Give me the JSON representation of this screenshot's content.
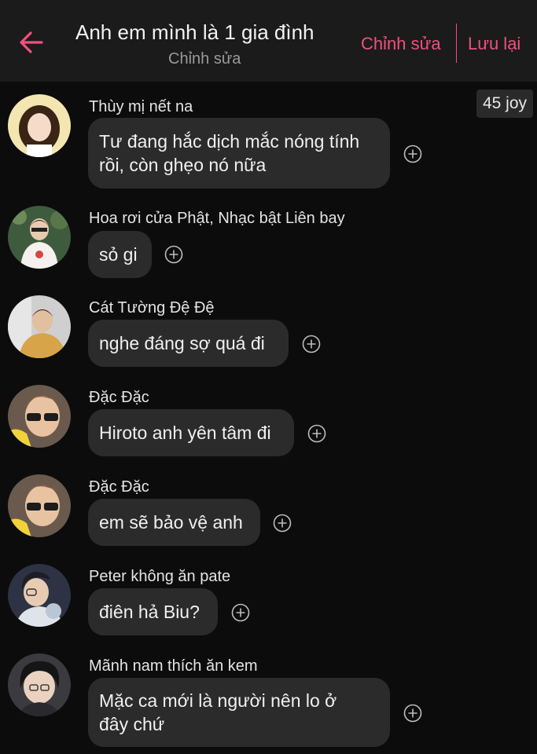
{
  "header": {
    "title": "Anh em mình là 1 gia đình",
    "subtitle": "Chỉnh sửa",
    "edit_label": "Chỉnh sửa",
    "save_label": "Lưu lại"
  },
  "badge": {
    "text": "45 joy"
  },
  "colors": {
    "accent": "#f0507e",
    "background": "#0c0c0c",
    "bubble": "#2b2b2b"
  },
  "messages": [
    {
      "sender": "Thùy mị nết na",
      "line1": "Tư đang hắc dịch mắc nóng tính",
      "line2": "rồi, còn ghẹo nó nữa"
    },
    {
      "sender": "Hoa rơi cửa Phật, Nhạc bật Liên bay",
      "line1": "sỏ gi"
    },
    {
      "sender": "Cát Tường Đệ Đệ",
      "line1": "nghe đáng sợ quá đi"
    },
    {
      "sender": "Đặc Đặc",
      "line1": "Hiroto anh yên tâm đi"
    },
    {
      "sender": "Đặc Đặc",
      "line1": "em sẽ bảo vệ anh"
    },
    {
      "sender": "Peter không ăn pate",
      "line1": "điên hả Biu?"
    },
    {
      "sender": "Mãnh nam thích ăn kem",
      "line1": "Mặc ca mới là người nên lo ở",
      "line2": "đây chứ"
    }
  ]
}
